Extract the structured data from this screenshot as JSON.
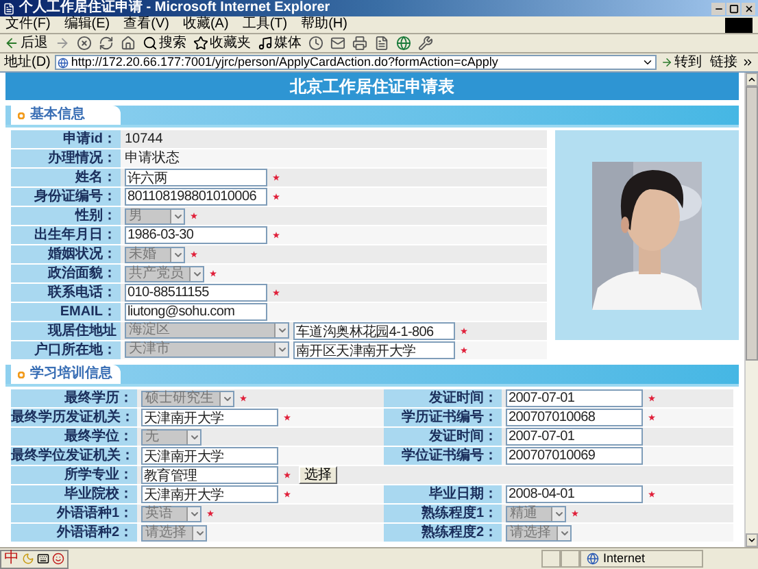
{
  "window": {
    "title": "个人工作居住证申请 - Microsoft Internet Explorer"
  },
  "menu": [
    "文件(F)",
    "编辑(E)",
    "查看(V)",
    "收藏(A)",
    "工具(T)",
    "帮助(H)"
  ],
  "toolbar": {
    "back": "后退",
    "search": "搜索",
    "favorites": "收藏夹",
    "media": "媒体"
  },
  "address_bar": {
    "label": "地址(D)",
    "url": "http://172.20.66.177:7001/yjrc/person/ApplyCardAction.do?formAction=cApply",
    "go": "转到",
    "links": "链接"
  },
  "page_title": "北京工作居住证申请表",
  "basic_info": {
    "title": "基本信息",
    "rows": [
      {
        "label": "申请id：",
        "kind": "text",
        "value": "10744",
        "required": false
      },
      {
        "label": "办理情况：",
        "kind": "text",
        "value": "申请状态",
        "required": false
      },
      {
        "label": "姓名：",
        "kind": "input",
        "value": "许六两",
        "required": true
      },
      {
        "label": "身份证编号：",
        "kind": "input",
        "value": "801108198801010006",
        "required": true
      },
      {
        "label": "性别：",
        "kind": "select",
        "value": "男",
        "required": true
      },
      {
        "label": "出生年月日：",
        "kind": "input",
        "value": "1986-03-30",
        "required": true
      },
      {
        "label": "婚姻状况：",
        "kind": "select",
        "value": "未婚",
        "required": true
      },
      {
        "label": "政治面貌：",
        "kind": "select",
        "value": "共产党员",
        "required": true
      },
      {
        "label": "联系电话：",
        "kind": "input",
        "value": "010-88511155",
        "required": true
      },
      {
        "label": "EMAIL：",
        "kind": "input",
        "value": "liutong@sohu.com",
        "required": false
      },
      {
        "label": "现居住地址",
        "kind": "select_input",
        "select_value": "海淀区",
        "value": "车道沟奥林花园4-1-806",
        "required": true
      },
      {
        "label": "户口所在地：",
        "kind": "select_input",
        "select_value": "天津市",
        "value": "南开区天津南开大学",
        "required": true
      }
    ]
  },
  "education": {
    "title": "学习培训信息",
    "rows": [
      {
        "left": {
          "label": "最终学历：",
          "kind": "select",
          "value": "硕士研究生",
          "required": true
        },
        "right": {
          "label": "发证时间：",
          "kind": "input",
          "value": "2007-07-01",
          "required": true
        }
      },
      {
        "left": {
          "label": "最终学历发证机关：",
          "kind": "input",
          "value": "天津南开大学",
          "required": true
        },
        "right": {
          "label": "学历证书编号：",
          "kind": "input",
          "value": "200707010068",
          "required": true
        }
      },
      {
        "left": {
          "label": "最终学位：",
          "kind": "select",
          "value": "无",
          "required": false
        },
        "right": {
          "label": "发证时间：",
          "kind": "input",
          "value": "2007-07-01",
          "required": false
        }
      },
      {
        "left": {
          "label": "最终学位发证机关：",
          "kind": "input",
          "value": "天津南开大学",
          "required": false
        },
        "right": {
          "label": "学位证书编号：",
          "kind": "input",
          "value": "200707010069",
          "required": false
        }
      },
      {
        "left": {
          "label": "所学专业：",
          "kind": "input",
          "value": "教育管理",
          "required": true,
          "button": "选择"
        }
      },
      {
        "left": {
          "label": "毕业院校：",
          "kind": "input",
          "value": "天津南开大学",
          "required": true
        },
        "right": {
          "label": "毕业日期：",
          "kind": "input",
          "value": "2008-04-01",
          "required": true
        }
      },
      {
        "left": {
          "label": "外语语种1：",
          "kind": "select",
          "value": "英语",
          "required": true
        },
        "right": {
          "label": "熟练程度1：",
          "kind": "select",
          "value": "精通",
          "required": true
        }
      },
      {
        "left": {
          "label": "外语语种2：",
          "kind": "select",
          "value": "请选择",
          "required": false
        },
        "right": {
          "label": "熟练程度2：",
          "kind": "select",
          "value": "请选择",
          "required": false
        }
      }
    ]
  },
  "ime_bar": {
    "mode": "中"
  },
  "status_bar": {
    "zone": "Internet"
  }
}
